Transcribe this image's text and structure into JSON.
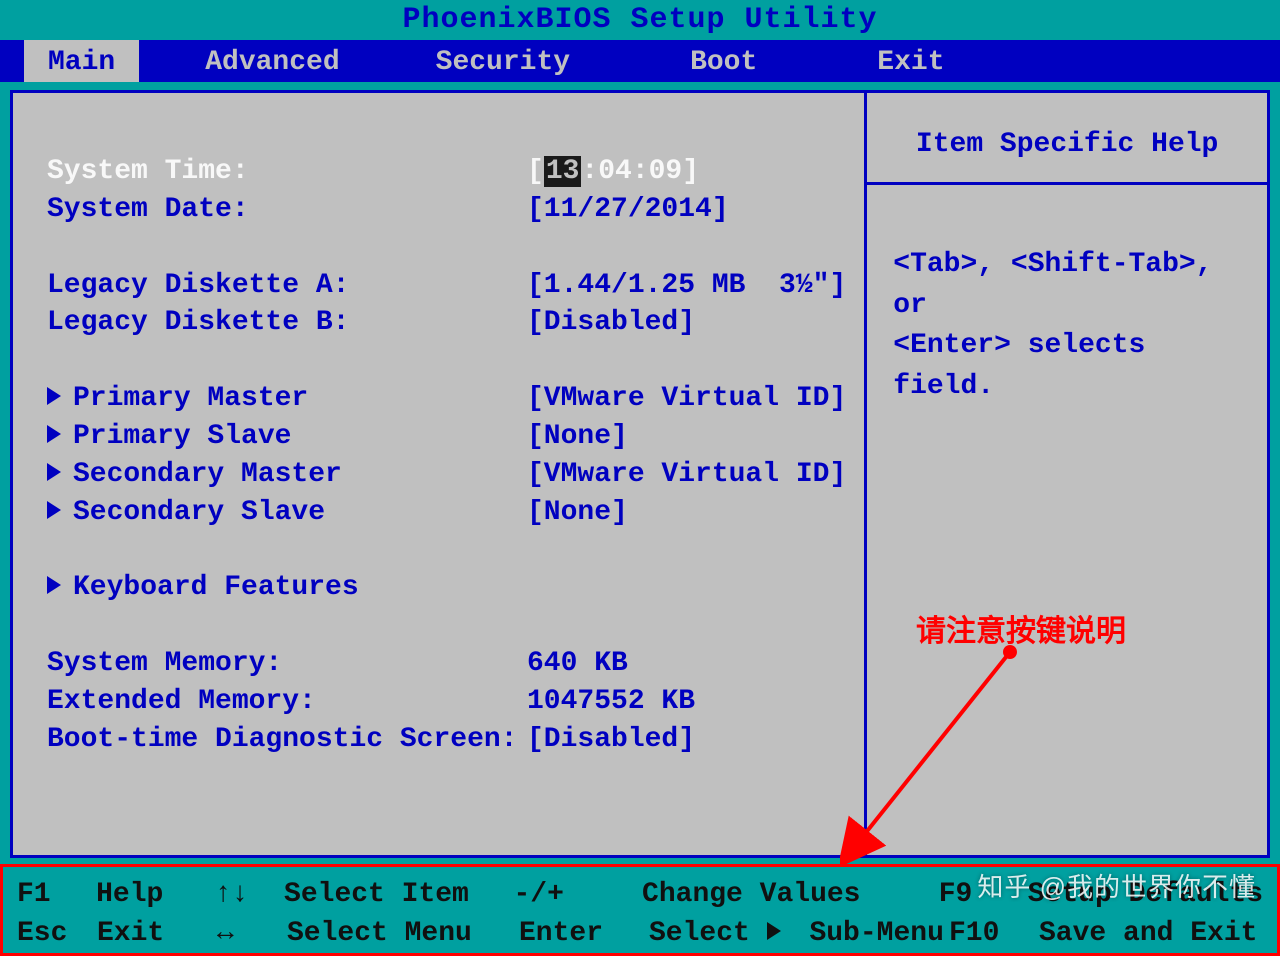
{
  "title": "PhoenixBIOS Setup Utility",
  "tabs": {
    "main": "Main",
    "advanced": "Advanced",
    "security": "Security",
    "boot": "Boot",
    "exit": "Exit"
  },
  "main": {
    "system_time_label": "System Time:",
    "system_time_hh": "13",
    "system_time_rest": ":04:09]",
    "system_date_label": "System Date:",
    "system_date_value": "[11/27/2014]",
    "legacy_a_label": "Legacy Diskette A:",
    "legacy_a_value": "[1.44/1.25 MB  3½\"]",
    "legacy_b_label": "Legacy Diskette B:",
    "legacy_b_value": "[Disabled]",
    "primary_master_label": "Primary Master",
    "primary_master_value": "[VMware Virtual ID]",
    "primary_slave_label": "Primary Slave",
    "primary_slave_value": "[None]",
    "secondary_master_label": "Secondary Master",
    "secondary_master_value": "[VMware Virtual ID]",
    "secondary_slave_label": "Secondary Slave",
    "secondary_slave_value": "[None]",
    "keyboard_features_label": "Keyboard Features",
    "system_memory_label": "System Memory:",
    "system_memory_value": "640 KB",
    "extended_memory_label": "Extended Memory:",
    "extended_memory_value": "1047552 KB",
    "boot_diag_label": "Boot-time Diagnostic Screen:",
    "boot_diag_value": "[Disabled]"
  },
  "help": {
    "title": "Item Specific Help",
    "body": "<Tab>, <Shift-Tab>, or\n<Enter> selects field."
  },
  "footer": {
    "f1": "F1",
    "f1v": "Help",
    "updown": "↑↓",
    "updownv": "Select Item",
    "pm": "-/+",
    "pmv": "Change Values",
    "f9": "F9",
    "f9v": "Setup Defaults",
    "esc": "Esc",
    "escv": "Exit",
    "lr": "↔",
    "lrv": "Select Menu",
    "enter": "Enter",
    "enterv_a": "Select",
    "enterv_b": "Sub-Menu",
    "f10": "F10",
    "f10v": "Save and Exit"
  },
  "annotation": "请注意按键说明",
  "watermark": "知乎 @我的世界你不懂"
}
